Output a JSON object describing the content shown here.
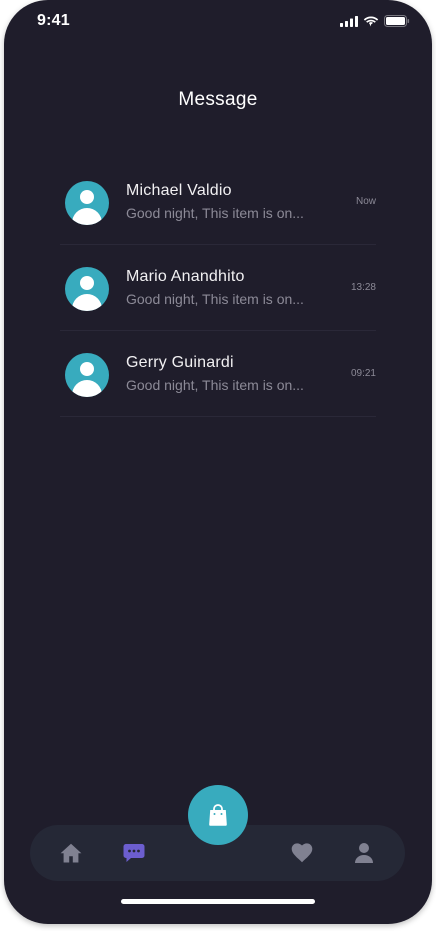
{
  "status_bar": {
    "time": "9:41"
  },
  "header": {
    "title": "Message"
  },
  "messages": [
    {
      "name": "Michael Valdio",
      "preview": "Good night, This item is on...",
      "time": "Now"
    },
    {
      "name": "Mario Anandhito",
      "preview": "Good night, This item is on...",
      "time": "13:28"
    },
    {
      "name": "Gerry Guinardi",
      "preview": "Good night, This item is on...",
      "time": "09:21"
    }
  ],
  "bottom_nav": {
    "items": [
      {
        "icon": "home-icon",
        "active": false
      },
      {
        "icon": "chat-icon",
        "active": true
      },
      {
        "icon": "heart-icon",
        "active": false
      },
      {
        "icon": "profile-icon",
        "active": false
      }
    ],
    "fab_icon": "shopping-bag-icon"
  },
  "colors": {
    "background": "#1f1d2b",
    "nav_background": "#252836",
    "accent": "#38abbe",
    "active_icon": "#6c5ecf",
    "inactive_icon": "#808191",
    "primary_text": "#f1f0f2",
    "secondary_text": "#8c8a97"
  }
}
